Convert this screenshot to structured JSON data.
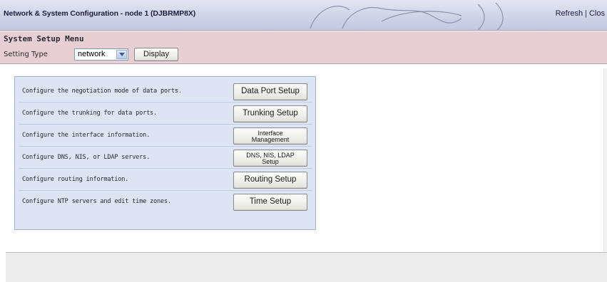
{
  "banner": {
    "title": "Network & System Configuration - node 1 (DJBRMP8X)",
    "links": {
      "refresh": "Refresh",
      "separator": "|",
      "close": "Clos"
    }
  },
  "menu": {
    "title": "System Setup Menu",
    "setting_type_label": "Setting Type",
    "setting_type_value": "network",
    "display_button": "Display"
  },
  "rows": [
    {
      "description": "Configure the negotiation mode of data ports.",
      "button": "Data Port Setup"
    },
    {
      "description": "Configure the trunking for data ports.",
      "button": "Trunking Setup"
    },
    {
      "description": "Configure the interface information.",
      "button_lines": [
        "Interface",
        "Management"
      ]
    },
    {
      "description": "Configure DNS, NIS, or LDAP servers.",
      "button_lines": [
        "DNS, NIS, LDAP",
        "Setup"
      ]
    },
    {
      "description": "Configure routing information.",
      "button": "Routing Setup"
    },
    {
      "description": "Configure NTP servers and edit time zones.",
      "button": "Time Setup"
    }
  ]
}
